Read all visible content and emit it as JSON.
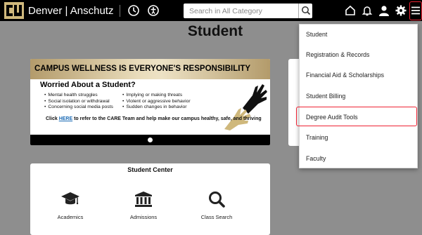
{
  "header": {
    "brand": "Denver | Anschutz",
    "search_placeholder": "Search in All Category"
  },
  "page": {
    "title": "Student"
  },
  "banner": {
    "heading": "CAMPUS WELLNESS IS EVERYONE'S RESPONSIBILITY",
    "subheading": "Worried About a Student?",
    "bullets_left": [
      "Mental health struggles",
      "Social isolation or withdrawal",
      "Concerning social media posts"
    ],
    "bullets_right": [
      "Implying or making threats",
      "Violent or aggressive behavior",
      "Sudden changes in behavior"
    ],
    "cta_before": "Click ",
    "cta_link": "HERE",
    "cta_after": " to refer to the CARE Team and help make our campus healthy, safe, and thriving",
    "prev": "‹",
    "next": "›"
  },
  "student_center": {
    "title": "Student Center",
    "tiles": [
      {
        "label": "Academics",
        "icon": "graduation-cap-icon"
      },
      {
        "label": "Admissions",
        "icon": "institution-icon"
      },
      {
        "label": "Class Search",
        "icon": "search-icon"
      }
    ]
  },
  "menu": {
    "items": [
      {
        "label": "Student"
      },
      {
        "label": "Registration & Records"
      },
      {
        "label": "Financial Aid & Scholarships"
      },
      {
        "label": "Student Billing"
      },
      {
        "label": "Degree Audit Tools",
        "highlighted": true
      },
      {
        "label": "Training"
      },
      {
        "label": "Faculty"
      }
    ]
  },
  "colors": {
    "topbar": "#000000",
    "background": "#8e8e8e",
    "gold": "#cfb87c",
    "highlight_border": "#e22233",
    "link": "#1b6bb5"
  }
}
